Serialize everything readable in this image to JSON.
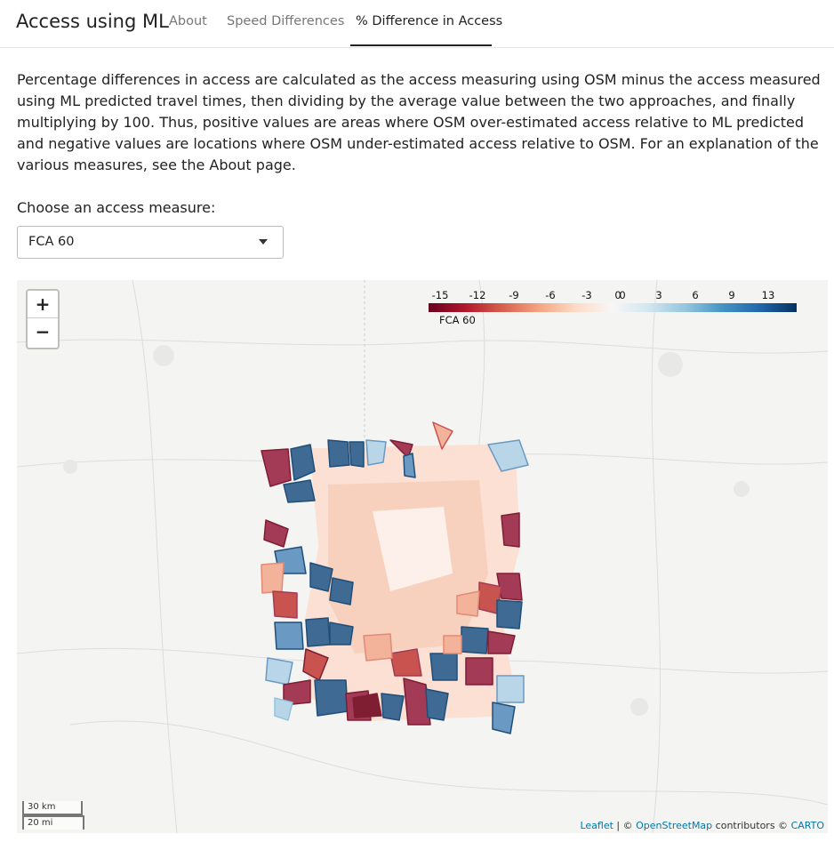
{
  "nav": {
    "brand": "Access using ML",
    "tabs": [
      "About",
      "Speed Differences",
      "% Difference in Access"
    ],
    "active_tab": "% Difference in Access"
  },
  "description": "Percentage differences in access are calculated as the access measuring using OSM minus the access measured using ML predicted travel times, then dividing by the average value between the two approaches, and finally multiplying by 100. Thus, positive values are areas where OSM over-estimated access relative to ML predicted and negative values are locations where OSM under-estimated access relative to OSM. For an explanation of the various measures, see the About page.",
  "select": {
    "label": "Choose an access measure:",
    "value": "FCA 60"
  },
  "map": {
    "zoom_in": "+",
    "zoom_out": "−",
    "legend": {
      "title": "FCA 60",
      "ticks": [
        "-15",
        "-12",
        "-9",
        "-6",
        "-3",
        "0",
        "0",
        "3",
        "6",
        "9",
        "13"
      ]
    },
    "scale": {
      "km": "30 km",
      "mi": "20 mi"
    },
    "attribution": {
      "leaflet": "Leaflet",
      "sep1": " | © ",
      "osm": "OpenStreetMap",
      "mid": " contributors © ",
      "carto": "CARTO"
    },
    "colors": {
      "dark_red": "#7f1d33",
      "red": "#c9534f",
      "light_red": "#f3b29a",
      "pale": "#fbe3d8",
      "light_blue": "#b9d5e8",
      "blue": "#6a9ac4",
      "dark_blue": "#1f4e79"
    }
  }
}
